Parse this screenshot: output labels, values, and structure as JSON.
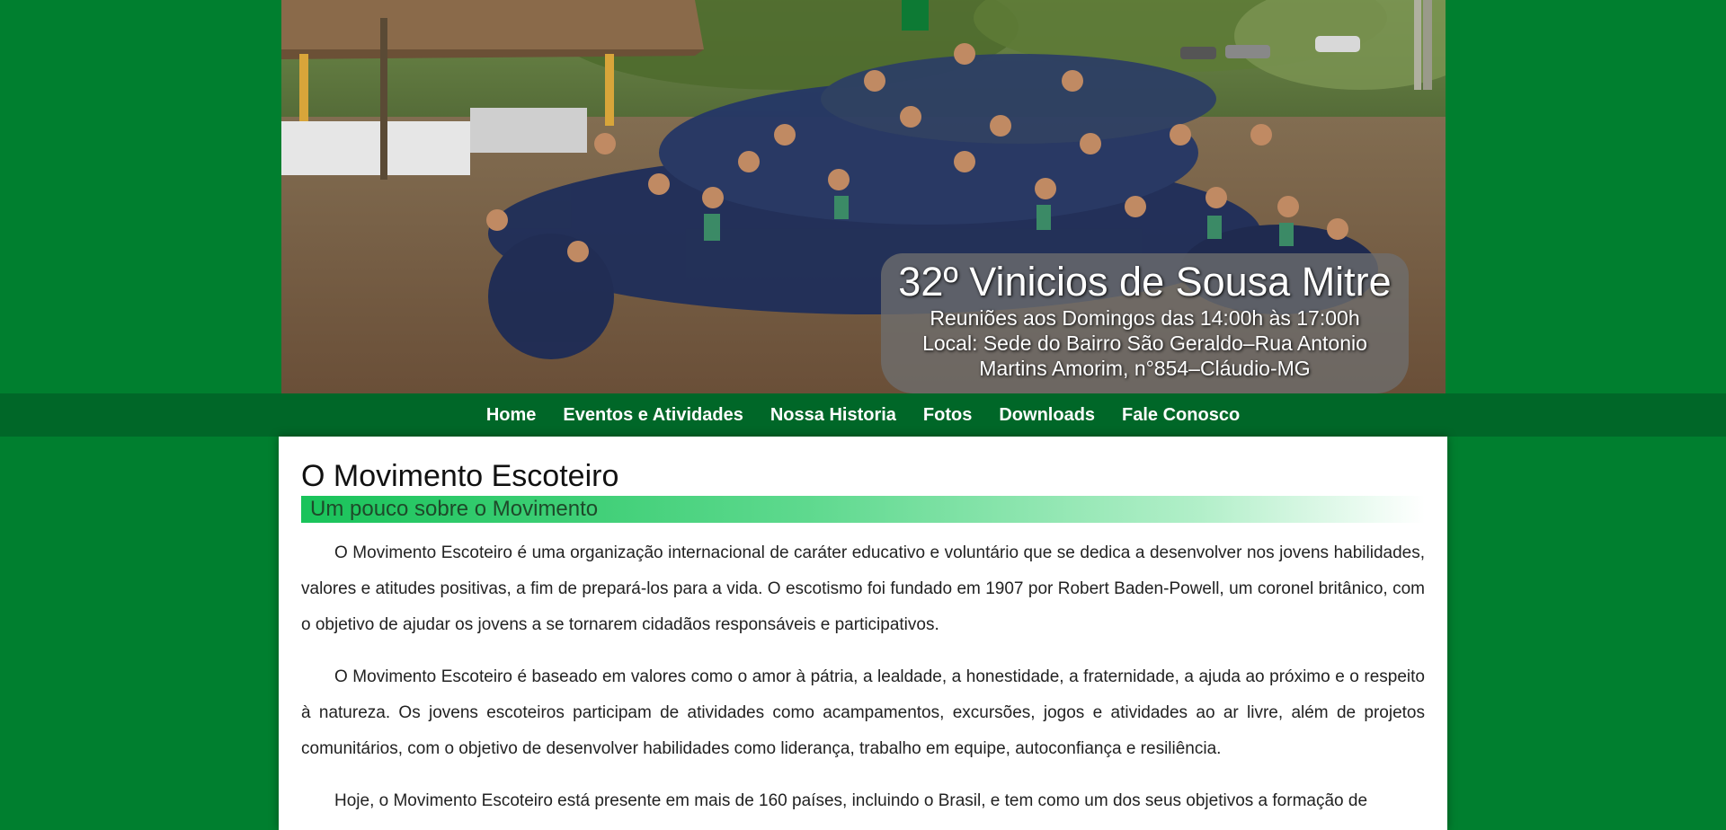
{
  "banner": {
    "title": "32º Vinicios de Sousa Mitre",
    "meeting": "Reuniões aos Domingos das 14:00h às 17:00h",
    "location_line1": "Local: Sede do Bairro São Geraldo–Rua Antonio",
    "location_line2": "Martins Amorim, n°854–Cláudio-MG"
  },
  "nav": {
    "items": [
      {
        "label": "Home"
      },
      {
        "label": "Eventos e Atividades"
      },
      {
        "label": "Nossa Historia"
      },
      {
        "label": "Fotos"
      },
      {
        "label": "Downloads"
      },
      {
        "label": "Fale Conosco"
      }
    ]
  },
  "main": {
    "title": "O Movimento Escoteiro",
    "subtitle": "Um pouco sobre o Movimento",
    "paragraphs": [
      "O Movimento Escoteiro é uma organização internacional de caráter educativo e voluntário que se dedica a desenvolver nos jovens habilidades, valores e atitudes positivas, a fim de prepará-los para a vida. O escotismo foi fundado em 1907 por Robert Baden-Powell, um coronel britânico, com o objetivo de ajudar os jovens a se tornarem cidadãos responsáveis e participativos.",
      "O Movimento Escoteiro é baseado em valores como o amor à pátria, a lealdade, a honestidade, a fraternidade, a ajuda ao próximo e o respeito à natureza. Os jovens escoteiros participam de atividades como acampamentos, excursões, jogos e atividades ao ar livre, além de projetos comunitários, com o objetivo de desenvolver habilidades como liderança, trabalho em equipe, autoconfiança e resiliência.",
      "Hoje, o Movimento Escoteiro está presente em mais de 160 países, incluindo o Brasil, e tem como um dos seus objetivos a formação de"
    ]
  },
  "colors": {
    "page_bg": "#007f2f",
    "nav_bg": "#006728",
    "accent": "#19c35a"
  }
}
